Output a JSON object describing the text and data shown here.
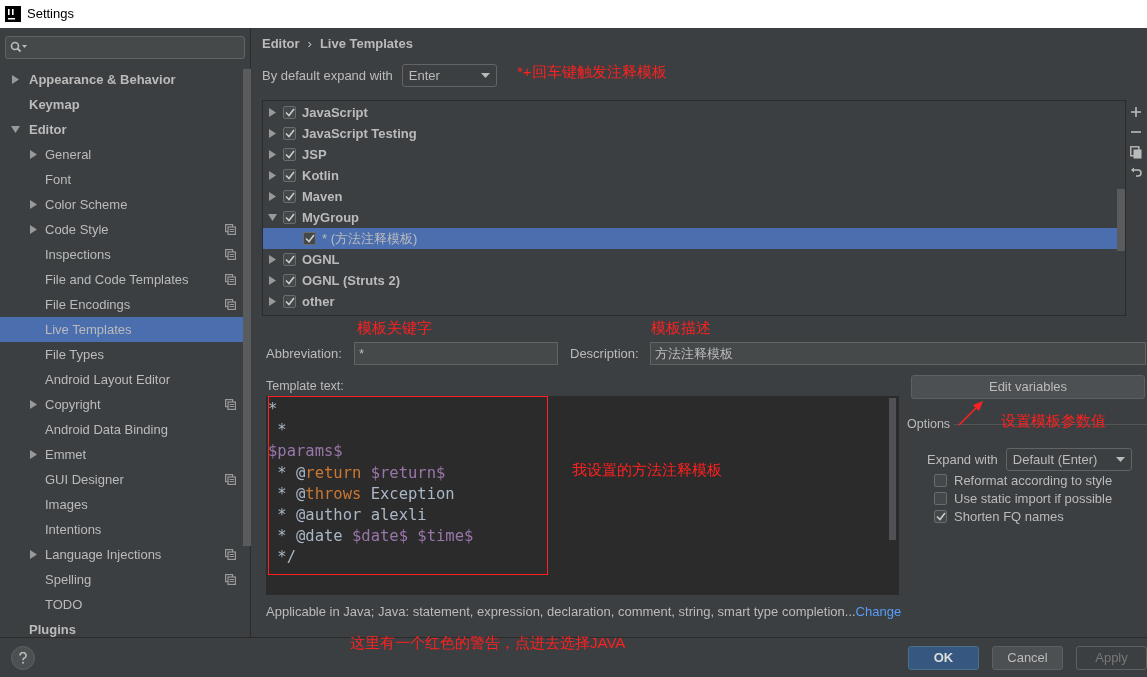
{
  "window": {
    "title": "Settings"
  },
  "sidebar": {
    "items": [
      {
        "label": "Appearance & Behavior",
        "bold": true,
        "expanded": false,
        "has_children": true,
        "selected": false,
        "project_level": false
      },
      {
        "label": "Keymap",
        "bold": true,
        "has_children": false,
        "selected": false,
        "project_level": false
      },
      {
        "label": "Editor",
        "bold": true,
        "expanded": true,
        "has_children": true,
        "selected": false,
        "project_level": false,
        "children": [
          {
            "label": "General",
            "has_children": true,
            "expanded": false,
            "selected": false,
            "project_level": false
          },
          {
            "label": "Font",
            "has_children": false,
            "selected": false,
            "project_level": false
          },
          {
            "label": "Color Scheme",
            "has_children": true,
            "expanded": false,
            "selected": false,
            "project_level": false
          },
          {
            "label": "Code Style",
            "has_children": true,
            "expanded": false,
            "selected": false,
            "project_level": true
          },
          {
            "label": "Inspections",
            "has_children": false,
            "selected": false,
            "project_level": true
          },
          {
            "label": "File and Code Templates",
            "has_children": false,
            "selected": false,
            "project_level": true
          },
          {
            "label": "File Encodings",
            "has_children": false,
            "selected": false,
            "project_level": true
          },
          {
            "label": "Live Templates",
            "has_children": false,
            "selected": true,
            "project_level": false
          },
          {
            "label": "File Types",
            "has_children": false,
            "selected": false,
            "project_level": false
          },
          {
            "label": "Android Layout Editor",
            "has_children": false,
            "selected": false,
            "project_level": false
          },
          {
            "label": "Copyright",
            "has_children": true,
            "expanded": false,
            "selected": false,
            "project_level": true
          },
          {
            "label": "Android Data Binding",
            "has_children": false,
            "selected": false,
            "project_level": false
          },
          {
            "label": "Emmet",
            "has_children": true,
            "expanded": false,
            "selected": false,
            "project_level": false
          },
          {
            "label": "GUI Designer",
            "has_children": false,
            "selected": false,
            "project_level": true
          },
          {
            "label": "Images",
            "has_children": false,
            "selected": false,
            "project_level": false
          },
          {
            "label": "Intentions",
            "has_children": false,
            "selected": false,
            "project_level": false
          },
          {
            "label": "Language Injections",
            "has_children": true,
            "expanded": false,
            "selected": false,
            "project_level": true
          },
          {
            "label": "Spelling",
            "has_children": false,
            "selected": false,
            "project_level": true
          },
          {
            "label": "TODO",
            "has_children": false,
            "selected": false,
            "project_level": false
          }
        ]
      },
      {
        "label": "Plugins",
        "bold": true,
        "has_children": false,
        "selected": false,
        "project_level": false
      }
    ]
  },
  "breadcrumb": {
    "parent": "Editor",
    "separator": "›",
    "current": "Live Templates"
  },
  "expand_default": {
    "label": "By default expand with",
    "value": "Enter"
  },
  "templates": [
    {
      "label": "JavaScript",
      "checked": true,
      "expanded": false,
      "selected": false
    },
    {
      "label": "JavaScript Testing",
      "checked": true,
      "expanded": false,
      "selected": false
    },
    {
      "label": "JSP",
      "checked": true,
      "expanded": false,
      "selected": false
    },
    {
      "label": "Kotlin",
      "checked": true,
      "expanded": false,
      "selected": false
    },
    {
      "label": "Maven",
      "checked": true,
      "expanded": false,
      "selected": false
    },
    {
      "label": "MyGroup",
      "checked": true,
      "expanded": true,
      "selected": false,
      "children": [
        {
          "label": "* (方法注释模板)",
          "checked": true,
          "selected": true
        }
      ]
    },
    {
      "label": "OGNL",
      "checked": true,
      "expanded": false,
      "selected": false
    },
    {
      "label": "OGNL (Struts 2)",
      "checked": true,
      "expanded": false,
      "selected": false
    },
    {
      "label": "other",
      "checked": true,
      "expanded": false,
      "selected": false
    }
  ],
  "abbreviation": {
    "label": "Abbreviation:",
    "value": "*"
  },
  "description": {
    "label": "Description:",
    "value": "方法注释模板"
  },
  "template_text": {
    "label": "Template text:",
    "lines": [
      [
        {
          "kind": "plain",
          "text": "*"
        }
      ],
      [
        {
          "kind": "plain",
          "text": " *"
        }
      ],
      [
        {
          "kind": "variable",
          "text": "$params$"
        }
      ],
      [
        {
          "kind": "plain",
          "text": " * @"
        },
        {
          "kind": "tag",
          "text": "return"
        },
        {
          "kind": "variable",
          "text": " $return$"
        }
      ],
      [
        {
          "kind": "plain",
          "text": " * @"
        },
        {
          "kind": "tag",
          "text": "throws"
        },
        {
          "kind": "plain",
          "text": " Exception"
        }
      ],
      [
        {
          "kind": "plain",
          "text": " * @author alexli"
        }
      ],
      [
        {
          "kind": "plain",
          "text": " * @date "
        },
        {
          "kind": "variable",
          "text": "$date$ $time$"
        }
      ],
      [
        {
          "kind": "plain",
          "text": " */"
        }
      ]
    ]
  },
  "edit_variables": "Edit variables",
  "options": {
    "title": "Options",
    "expand_with": {
      "label": "Expand with",
      "value": "Default (Enter)"
    },
    "checkboxes": [
      {
        "label": "Reformat according to style",
        "checked": false
      },
      {
        "label": "Use static import if possible",
        "checked": false
      },
      {
        "label": "Shorten FQ names",
        "checked": true
      }
    ]
  },
  "applicable": {
    "text": "Applicable in Java; Java: statement, expression, declaration, comment, string, smart type completion...",
    "link": "Change"
  },
  "buttons": [
    {
      "label": "OK",
      "kind": "primary",
      "disabled": false
    },
    {
      "label": "Cancel",
      "kind": "normal",
      "disabled": false
    },
    {
      "label": "Apply",
      "kind": "normal",
      "disabled": true
    }
  ],
  "annotations": [
    "*+回车键触发注释模板",
    "模板关键字",
    "模板描述",
    "我设置的方法注释模板",
    "设置模板参数值",
    "这里有一个红色的警告，点进去选择JAVA"
  ]
}
